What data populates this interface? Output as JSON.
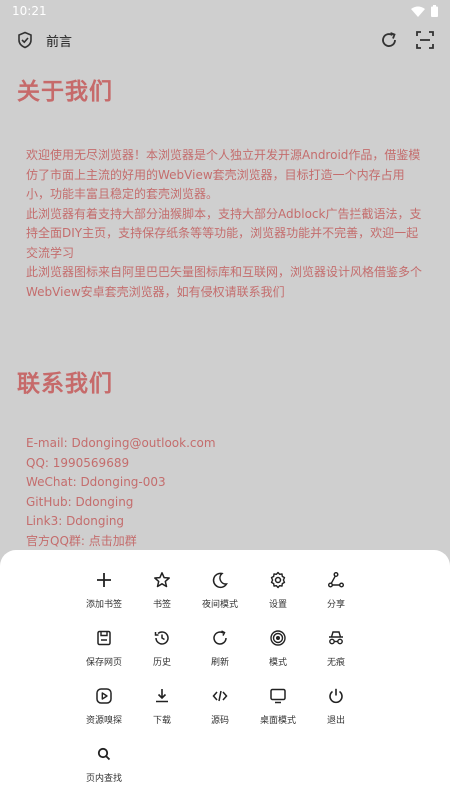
{
  "status": {
    "time": "10:21"
  },
  "toolbar": {
    "title": "前言"
  },
  "about": {
    "heading": "关于我们",
    "paragraphs": [
      "欢迎使用无尽浏览器！本浏览器是个人独立开发开源Android作品，借鉴模仿了市面上主流的好用的WebView套壳浏览器，目标打造一个内存占用小，功能丰富且稳定的套壳浏览器。",
      "此浏览器有着支持大部分油猴脚本，支持大部分Adblock广告拦截语法，支持全面DIY主页，支持保存纸条等等功能，浏览器功能并不完善，欢迎一起交流学习",
      "此浏览器图标来自阿里巴巴矢量图标库和互联网，浏览器设计风格借鉴多个WebView安卓套壳浏览器，如有侵权请联系我们"
    ]
  },
  "contact": {
    "heading": "联系我们",
    "lines": [
      "E-mail: Ddonging@outlook.com",
      "QQ: 1990569689",
      "WeChat: Ddonging-003",
      "GitHub: Ddonging",
      "Link3: Ddonging",
      "官方QQ群: 点击加群"
    ]
  },
  "menu": {
    "items": [
      {
        "label": "添加书签",
        "icon": "plus-icon"
      },
      {
        "label": "书签",
        "icon": "star-icon"
      },
      {
        "label": "夜间模式",
        "icon": "moon-icon"
      },
      {
        "label": "设置",
        "icon": "gear-icon"
      },
      {
        "label": "分享",
        "icon": "share-icon"
      },
      {
        "label": "保存网页",
        "icon": "save-icon"
      },
      {
        "label": "历史",
        "icon": "history-icon"
      },
      {
        "label": "刷新",
        "icon": "refresh-icon"
      },
      {
        "label": "模式",
        "icon": "fingerprint-icon"
      },
      {
        "label": "无痕",
        "icon": "incognito-icon"
      },
      {
        "label": "资源嗅探",
        "icon": "play-icon"
      },
      {
        "label": "下载",
        "icon": "download-icon"
      },
      {
        "label": "源码",
        "icon": "code-icon"
      },
      {
        "label": "桌面模式",
        "icon": "desktop-icon"
      },
      {
        "label": "退出",
        "icon": "power-icon"
      },
      {
        "label": "页内查找",
        "icon": "search-icon"
      }
    ]
  },
  "colors": {
    "accent": "#c66a6a",
    "backdrop": "#cfcfcf"
  }
}
